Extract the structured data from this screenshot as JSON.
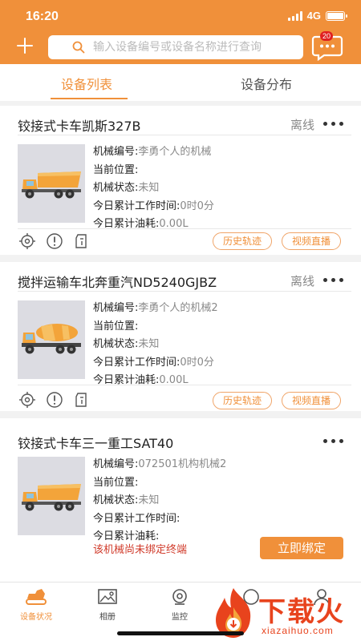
{
  "status_bar": {
    "time": "16:20",
    "network": "4G"
  },
  "search": {
    "placeholder": "输入设备编号或设备名称进行查询"
  },
  "messages": {
    "badge": "20"
  },
  "tabs": [
    {
      "label": "设备列表",
      "active": true
    },
    {
      "label": "设备分布",
      "active": false
    }
  ],
  "devices": [
    {
      "title": "铰接式卡车凯斯327B",
      "status": "离线",
      "image": "dump-truck",
      "fields": [
        {
          "key": "机械编号:",
          "value": "李勇个人的机械"
        },
        {
          "key": "当前位置:",
          "value": ""
        },
        {
          "key": "机械状态:",
          "value": "未知"
        },
        {
          "key": "今日累计工作时间:",
          "value": "0时0分"
        },
        {
          "key": "今日累计油耗:",
          "value": "0.00L"
        }
      ],
      "actions": {
        "history": "历史轨迹",
        "video": "视频直播"
      }
    },
    {
      "title": "搅拌运输车北奔重汽ND5240GJBZ",
      "status": "离线",
      "image": "concrete-mixer-truck",
      "fields": [
        {
          "key": "机械编号:",
          "value": "李勇个人的机械2"
        },
        {
          "key": "当前位置:",
          "value": ""
        },
        {
          "key": "机械状态:",
          "value": "未知"
        },
        {
          "key": "今日累计工作时间:",
          "value": "0时0分"
        },
        {
          "key": "今日累计油耗:",
          "value": "0.00L"
        }
      ],
      "actions": {
        "history": "历史轨迹",
        "video": "视频直播"
      }
    },
    {
      "title": "铰接式卡车三一重工SAT40",
      "status": "",
      "image": "dump-truck",
      "fields": [
        {
          "key": "机械编号:",
          "value": "072501机构机械2"
        },
        {
          "key": "当前位置:",
          "value": ""
        },
        {
          "key": "机械状态:",
          "value": "未知"
        },
        {
          "key": "今日累计工作时间:",
          "value": ""
        },
        {
          "key": "今日累计油耗:",
          "value": ""
        }
      ],
      "warning": "该机械尚未绑定终端",
      "bind_label": "立即绑定"
    }
  ],
  "bottom_nav": [
    {
      "label": "设备状况",
      "icon": "excavator-icon",
      "active": true
    },
    {
      "label": "相册",
      "icon": "album-icon",
      "active": false
    },
    {
      "label": "监控",
      "icon": "camera-icon",
      "active": false
    },
    {
      "label": "",
      "icon": "circle-icon",
      "active": false
    },
    {
      "label": "",
      "icon": "user-icon",
      "active": false
    }
  ],
  "watermark": {
    "text": "下载火",
    "url": "xiazaihuo.com"
  },
  "colors": {
    "brand": "#f0903a",
    "warning": "#d03a2a",
    "watermark": "#e8431d"
  }
}
